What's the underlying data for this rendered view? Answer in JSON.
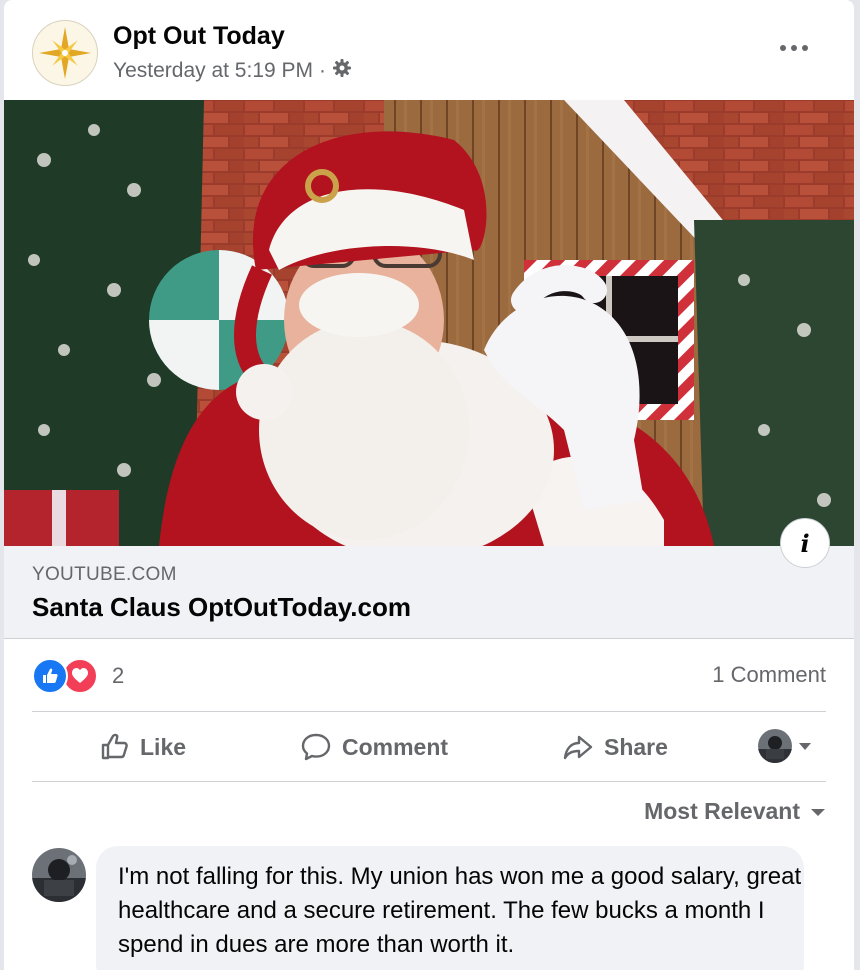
{
  "post": {
    "page_name": "Opt Out Today",
    "timestamp": "Yesterday at 5:19 PM",
    "separator": "·",
    "audience_icon": "gear-icon",
    "more_icon": "more-horizontal-icon"
  },
  "link": {
    "domain": "YOUTUBE.COM",
    "title": "Santa Claus OptOutToday.com",
    "info_label": "i"
  },
  "stats": {
    "reaction_count": "2",
    "reactions": [
      "like",
      "love"
    ],
    "comment_count": "1 Comment"
  },
  "actions": {
    "like": "Like",
    "comment": "Comment",
    "share": "Share"
  },
  "comments": {
    "sort_label": "Most Relevant",
    "items": [
      {
        "text": "I'm not falling for this. My union has won me a good salary, great healthcare and a secure retirement. The few bucks a month I spend in dues are more than worth it."
      }
    ]
  },
  "colors": {
    "like_blue": "#1877f2",
    "love_red": "#f33e58",
    "secondary_text": "#65676b",
    "link_bg": "#f0f2f5"
  }
}
